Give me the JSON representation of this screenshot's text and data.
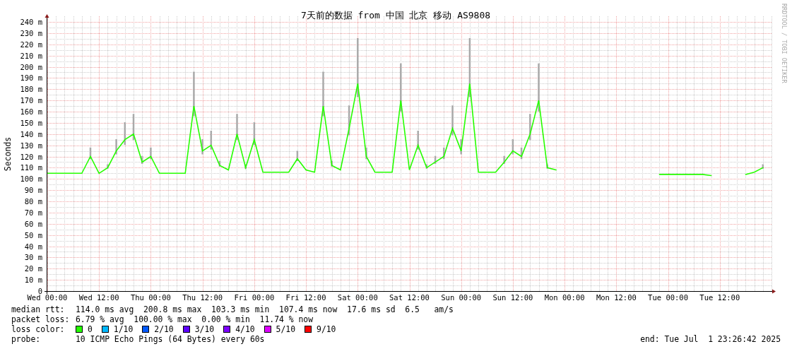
{
  "graph": {
    "side_note": "RRDTOOL / TOBI OETIKER",
    "chart_data": {
      "type": "line",
      "title": "7天前的数据 from 中国 北京 移动 AS9808",
      "ylabel": "Seconds",
      "grid": true,
      "categories": [
        "Wed 00:00",
        null,
        null,
        null,
        null,
        null,
        "Wed 12:00",
        null,
        null,
        null,
        null,
        null,
        "Thu 00:00",
        null,
        null,
        null,
        null,
        null,
        "Thu 12:00",
        null,
        null,
        null,
        null,
        null,
        "Fri 00:00",
        null,
        null,
        null,
        null,
        null,
        "Fri 12:00",
        null,
        null,
        null,
        null,
        null,
        "Sat 00:00",
        null,
        null,
        null,
        null,
        null,
        "Sat 12:00",
        null,
        null,
        null,
        null,
        null,
        "Sun 00:00",
        null,
        null,
        null,
        null,
        null,
        "Sun 12:00",
        null,
        null,
        null,
        null,
        null,
        "Mon 00:00",
        null,
        null,
        null,
        null,
        null,
        "Mon 12:00",
        null,
        null,
        null,
        null,
        null,
        "Tue 00:00",
        null,
        null,
        null,
        null,
        null,
        "Tue 12:00",
        null,
        null,
        null,
        null,
        null
      ],
      "series": [
        {
          "color": "#26ff00",
          "values": [
            105,
            105,
            105,
            105,
            105,
            120,
            105,
            110,
            125,
            135,
            140,
            115,
            120,
            105,
            105,
            105,
            105,
            165,
            125,
            130,
            112,
            108,
            140,
            110,
            135,
            106,
            106,
            106,
            106,
            118,
            108,
            106,
            165,
            112,
            108,
            145,
            185,
            120,
            106,
            106,
            106,
            170,
            108,
            130,
            110,
            115,
            120,
            145,
            125,
            185,
            106,
            106,
            106,
            115,
            125,
            120,
            140,
            170,
            110,
            108,
            null,
            null,
            null,
            null,
            null,
            null,
            null,
            null,
            null,
            null,
            null,
            104,
            104,
            104,
            104,
            104,
            104,
            103,
            null,
            null,
            null,
            104,
            106,
            110
          ]
        }
      ],
      "ylim": [
        0,
        240
      ],
      "yticks": [
        {
          "value": 0,
          "label": "0"
        },
        {
          "value": 10,
          "label": "10 m"
        },
        {
          "value": 20,
          "label": "20 m"
        },
        {
          "value": 30,
          "label": "30 m"
        },
        {
          "value": 40,
          "label": "40 m"
        },
        {
          "value": 50,
          "label": "50 m"
        },
        {
          "value": 60,
          "label": "60 m"
        },
        {
          "value": 70,
          "label": "70 m"
        },
        {
          "value": 80,
          "label": "80 m"
        },
        {
          "value": 90,
          "label": "90 m"
        },
        {
          "value": 100,
          "label": "100 m"
        },
        {
          "value": 110,
          "label": "110 m"
        },
        {
          "value": 120,
          "label": "120 m"
        },
        {
          "value": 130,
          "label": "130 m"
        },
        {
          "value": 140,
          "label": "140 m"
        },
        {
          "value": 150,
          "label": "150 m"
        },
        {
          "value": 160,
          "label": "160 m"
        },
        {
          "value": 170,
          "label": "170 m"
        },
        {
          "value": 180,
          "label": "180 m"
        },
        {
          "value": 190,
          "label": "190 m"
        },
        {
          "value": 200,
          "label": "200 m"
        },
        {
          "value": 210,
          "label": "210 m"
        },
        {
          "value": 220,
          "label": "220 m"
        },
        {
          "value": 230,
          "label": "230 m"
        },
        {
          "value": 240,
          "label": "240 m"
        }
      ]
    }
  },
  "legend": {
    "stats": [
      {
        "label": "median rtt:",
        "value": "114.0 ms avg  200.8 ms max  103.3 ms min  107.4 ms now  17.6 ms sd  6.5   am/s"
      },
      {
        "label": "packet loss:",
        "value": "6.79 % avg  100.00 % max  0.00 % min  11.74 % now"
      }
    ],
    "loss_label": "loss color:",
    "loss_colors": [
      {
        "label": "0",
        "color": "#26ff00"
      },
      {
        "label": "1/10",
        "color": "#00b8ff"
      },
      {
        "label": "2/10",
        "color": "#0059ff"
      },
      {
        "label": "3/10",
        "color": "#5e00ff"
      },
      {
        "label": "4/10",
        "color": "#7e00ff"
      },
      {
        "label": "5/10",
        "color": "#dd00ff"
      },
      {
        "label": "9/10",
        "color": "#ff0000"
      }
    ],
    "probe_label": "probe:",
    "probe": "10 ICMP Echo Pings (64 Bytes) every 60s",
    "end": "end: Tue Jul  1 23:26:42 2025"
  }
}
